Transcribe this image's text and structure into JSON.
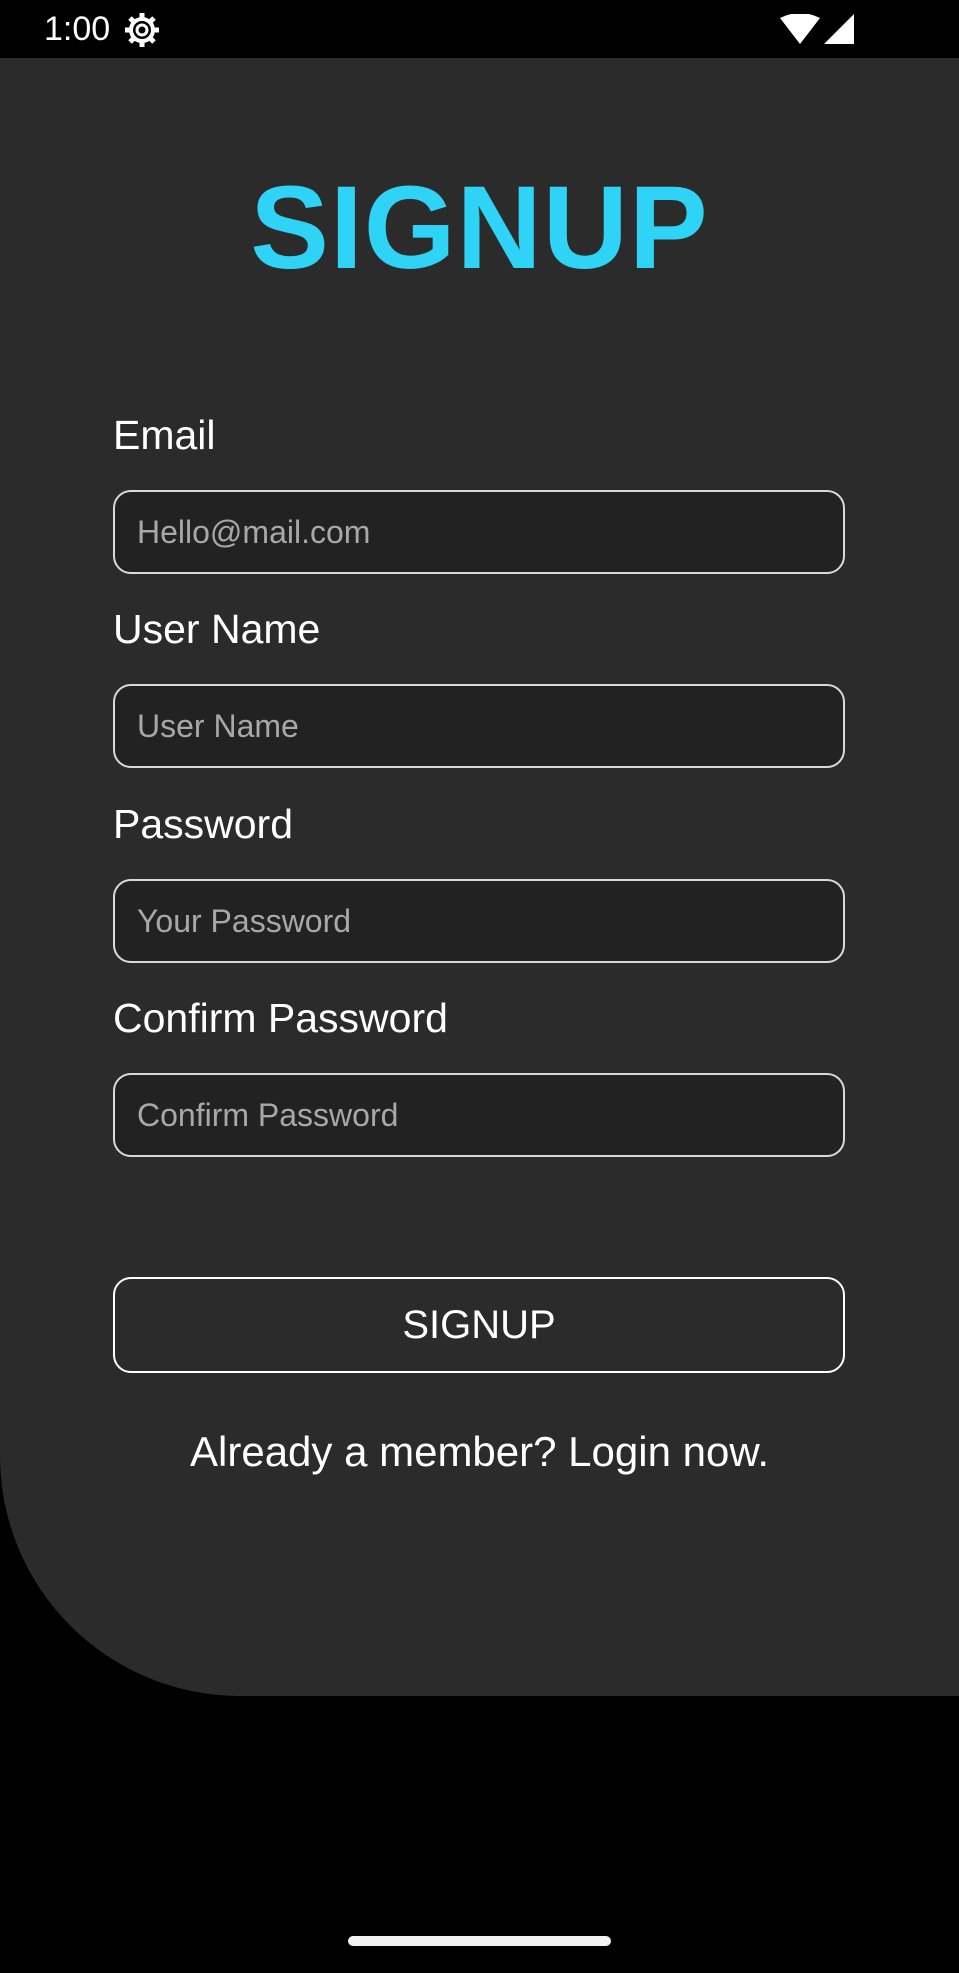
{
  "status_bar": {
    "time": "1:00",
    "icons": [
      "settings-gear-icon",
      "wifi-icon",
      "cell-signal-icon"
    ]
  },
  "colors": {
    "accent": "#2fd3f5",
    "card_background": "#2b2b2b",
    "page_background": "#000000",
    "input_background": "#222222",
    "input_border": "#d9d9d9",
    "placeholder": "#a8a8a8",
    "text": "#ffffff"
  },
  "signup_form": {
    "title": "SIGNUP",
    "email": {
      "label": "Email",
      "value": "",
      "placeholder": "Hello@mail.com"
    },
    "username": {
      "label": "User Name",
      "value": "",
      "placeholder": "User Name"
    },
    "password": {
      "label": "Password",
      "value": "",
      "placeholder": "Your Password"
    },
    "confirm_password": {
      "label": "Confirm Password",
      "value": "",
      "placeholder": "Confirm Password"
    },
    "submit_label": "SIGNUP",
    "login_prompt": "Already a member? Login now."
  }
}
